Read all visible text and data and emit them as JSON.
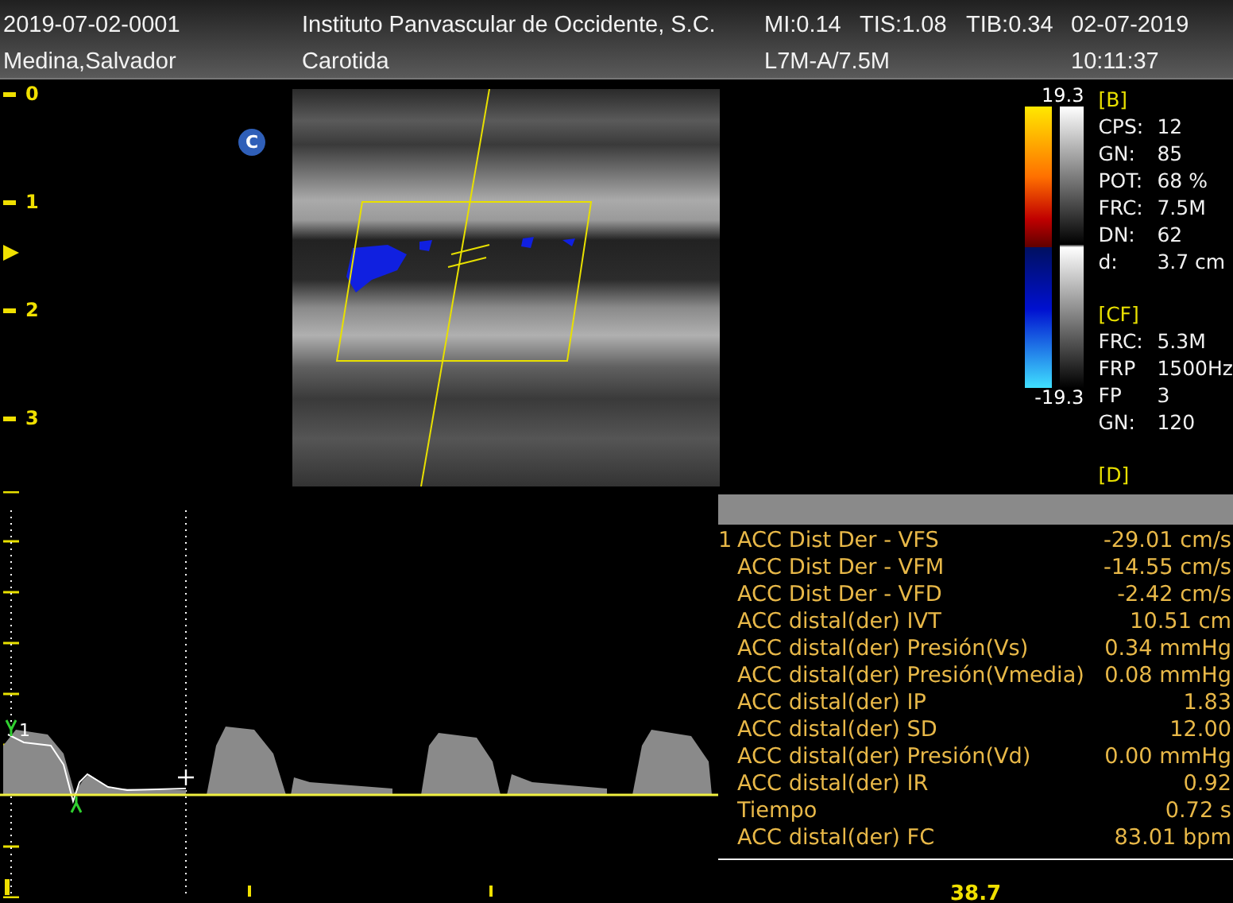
{
  "header": {
    "study_id": "2019-07-02-0001",
    "institution": "Instituto Panvascular de Occidente, S.C.",
    "indices": [
      "MI:0.14",
      "TIS:1.08",
      "TIB:0.34"
    ],
    "date": "02-07-2019",
    "patient": "Medina,Salvador",
    "exam": "Carotida",
    "probe": "L7M-A/7.5M",
    "time": "10:11:37"
  },
  "depth_scale": [
    "0",
    "1",
    "2",
    "3"
  ],
  "image": {
    "marker": "C"
  },
  "color_scale": {
    "max": "19.3",
    "min": "-19.3"
  },
  "parameters": [
    {
      "title": "[B]",
      "items": [
        {
          "label": "CPS:",
          "value": "12"
        },
        {
          "label": "GN:",
          "value": "85"
        },
        {
          "label": "POT:",
          "value": "68 %"
        },
        {
          "label": "FRC:",
          "value": "7.5M"
        },
        {
          "label": "DN:",
          "value": "62"
        },
        {
          "label": "d:",
          "value": "3.7 cm"
        }
      ]
    },
    {
      "title": "[CF]",
      "items": [
        {
          "label": "FRC:",
          "value": "5.3M"
        },
        {
          "label": "FRP",
          "value": "1500Hz"
        },
        {
          "label": "FP",
          "value": "3"
        },
        {
          "label": "GN:",
          "value": "120"
        }
      ]
    },
    {
      "title": "[D]"
    }
  ],
  "spectrum": {
    "trace_label": "1",
    "readout": "38.7"
  },
  "measurements": {
    "index": "1",
    "rows": [
      {
        "label": "ACC Dist Der - VFS",
        "value": "-29.01 cm/s"
      },
      {
        "label": "ACC Dist Der - VFM",
        "value": "-14.55 cm/s"
      },
      {
        "label": "ACC Dist Der - VFD",
        "value": "-2.42 cm/s"
      },
      {
        "label": "ACC distal(der) IVT",
        "value": "10.51 cm"
      },
      {
        "label": "ACC distal(der) Presión(Vs)",
        "value": "0.34 mmHg"
      },
      {
        "label": "ACC distal(der) Presión(Vmedia)",
        "value": "0.08 mmHg"
      },
      {
        "label": "ACC distal(der) IP",
        "value": "1.83"
      },
      {
        "label": "ACC distal(der) SD",
        "value": "12.00"
      },
      {
        "label": "ACC distal(der) Presión(Vd)",
        "value": "0.00 mmHg"
      },
      {
        "label": "ACC distal(der) IR",
        "value": "0.92"
      },
      {
        "label": "Tiempo",
        "value": "0.72 s"
      },
      {
        "label": "ACC distal(der) FC",
        "value": "83.01 bpm"
      }
    ]
  }
}
